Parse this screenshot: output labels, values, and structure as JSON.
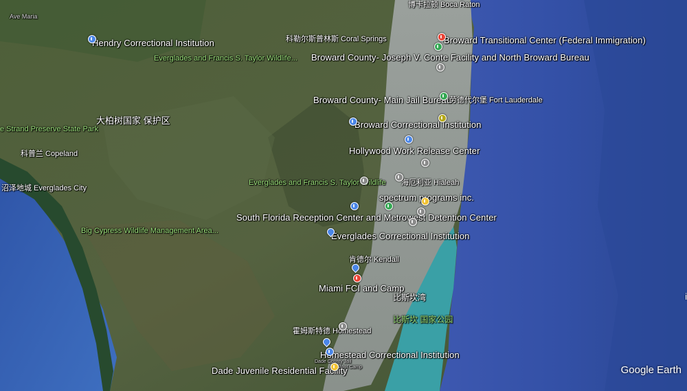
{
  "map": {
    "labels": {
      "ave_maria": "Ave Maria",
      "hendry": "Hendry Correctional Institution",
      "coral_springs": "科勒尔斯普林斯 Coral Springs",
      "boca_raton": "博卡拉顿 Boca Raton",
      "broward_transitional": "Broward Transitional Center (Federal Immigration)",
      "conte": "Broward County- Joseph V. Conte Facility and North Broward Bureau",
      "everglades_wildlife_1": "Everglades and Francis S. Taylor Wildlife...",
      "main_jail": "Broward County- Main Jail Bureau",
      "fort_lauderdale": "劳德代尔堡 Fort Lauderdale",
      "broward_ci": "Broward Correctional Institution",
      "strand": "e Strand Preserve State Park",
      "big_cypress_cn": "大柏树国家 保护区",
      "copeland": "科普兰 Copeland",
      "hollywood": "Hollywood Work Release Center",
      "everglades_city": "沼泽地城 Everglades City",
      "everglades_wildlife_2": "Everglades and Francis S. Taylor Wildlife",
      "hialeah": "海厄利亚 Hialeah",
      "spectrum": "spectrum programs inc.",
      "south_florida_reception": "South Florida Reception Center and Metrowest Detention Center",
      "big_cypress_wma": "Big Cypress Wildlife Management Area...",
      "everglades_ci": "Everglades Correctional Institution",
      "kendall": "肯德尔 Kendall",
      "miami_fci": "Miami FCI and Camp",
      "biscayne_bay": "比斯坎湾",
      "biscayne_np": "比斯坎 国家公园",
      "homestead": "霍姆斯特德 Homestead",
      "homestead_ci": "Homestead Correctional Institution",
      "homestead_small_1": "Dade County Jail",
      "homestead_small_2": "Boot Camp",
      "dade_juvenile": "Dade Juvenile Residential Facility",
      "edge_glyph": "i"
    },
    "logo": "Google Earth",
    "colors": {
      "pin_blue": "#4a86e8",
      "pin_green": "#34a853",
      "pin_olive": "#b5a81a",
      "pin_gray": "#8a8a8a",
      "pin_red": "#ea4335",
      "pin_yellow": "#f1c232",
      "ocean_deep": "#2e4a9e",
      "ocean_shallow": "#3fa7a5",
      "land": "#4a5a36",
      "urban": "#9a9f9a"
    }
  }
}
